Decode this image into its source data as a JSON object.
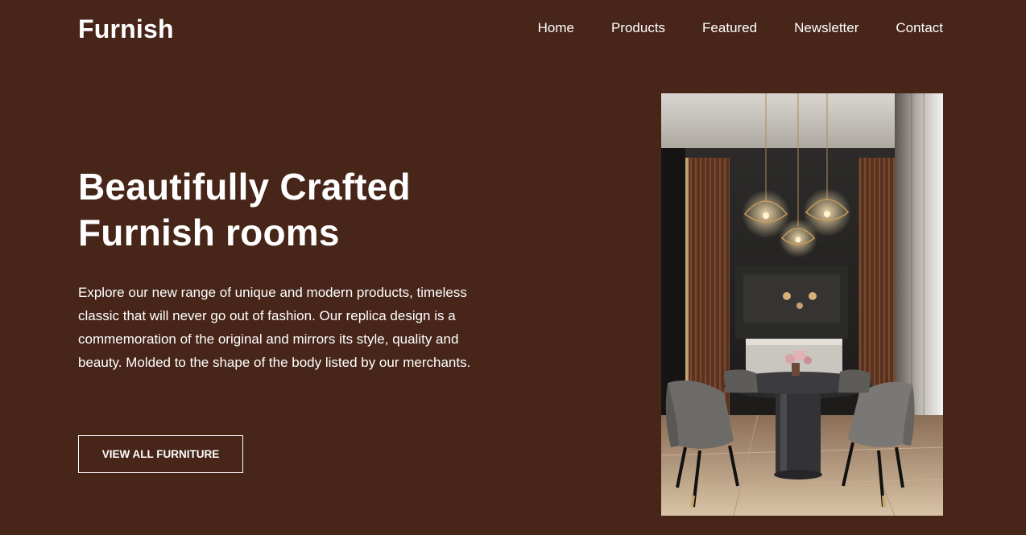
{
  "header": {
    "logo": "Furnish",
    "nav": [
      "Home",
      "Products",
      "Featured",
      "Newsletter",
      "Contact"
    ]
  },
  "hero": {
    "title_line1": "Beautifully Crafted",
    "title_line2": "Furnish rooms",
    "description": "Explore our new range of unique and modern products, timeless classic that will never go out of fashion. Our replica design is a commemoration of the original and mirrors its style, quality and beauty. Molded to the shape of the body listed by our merchants.",
    "cta_label": "VIEW ALL FURNITURE"
  },
  "colors": {
    "background": "#472518",
    "text": "#ffffff"
  }
}
